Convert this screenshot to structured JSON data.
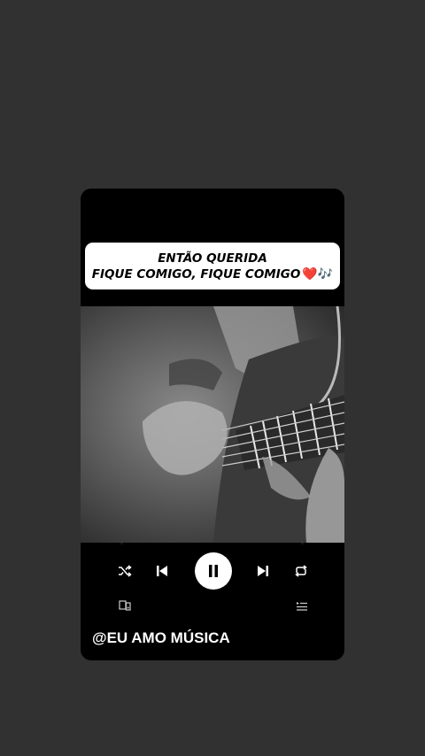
{
  "caption": {
    "line1": "ENTÃO QUERIDA",
    "line2": "FIQUE COMIGO, FIQUE COMIGO",
    "emoji_heart": "❤️",
    "emoji_notes": "🎶"
  },
  "player": {
    "state": "playing",
    "icons": [
      "shuffle-icon",
      "previous-icon",
      "pause-icon",
      "next-icon",
      "repeat-icon",
      "devices-icon",
      "queue-icon"
    ]
  },
  "watermark": "@EU AMO MÚSICA",
  "colors": {
    "background": "#313131",
    "card": "#000000",
    "caption_bg": "#ffffff",
    "heart": "#e02020"
  }
}
